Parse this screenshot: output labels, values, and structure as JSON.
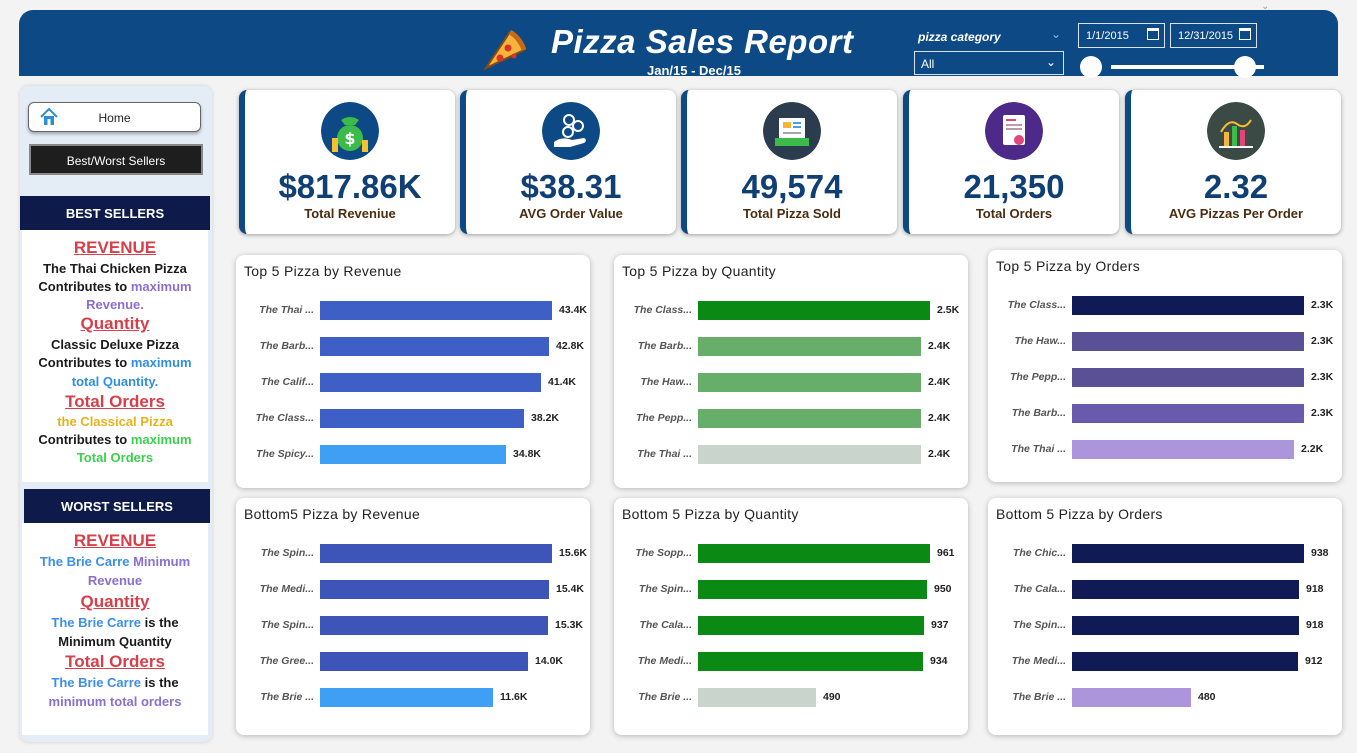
{
  "header": {
    "title": "Pizza Sales Report",
    "subtitle": "Jan/15 - Dec/15",
    "category_label": "pizza category",
    "category_value": "All",
    "date_start": "1/1/2015",
    "date_end": "12/31/2015"
  },
  "sidebar": {
    "home_label": "Home",
    "bw_label": "Best/Worst Sellers",
    "best": {
      "heading": "BEST SELLERS",
      "revenue_h": "REVENUE",
      "revenue_l1": "The Thai Chicken Pizza",
      "revenue_l2a": "Contributes to",
      "revenue_l2b": "maximum",
      "revenue_l3": "Revenue.",
      "quantity_h": "Quantity",
      "quantity_l1": "Classic Deluxe Pizza",
      "quantity_l2a": "Contributes to",
      "quantity_l2b": "maximum",
      "quantity_l3": "total Quantity.",
      "orders_h": "Total Orders",
      "orders_l1": "the Classical Pizza",
      "orders_l2a": "Contributes to",
      "orders_l2b": "maximum",
      "orders_l3": "Total Orders"
    },
    "worst": {
      "heading": "WORST SELLERS",
      "revenue_h": "REVENUE",
      "revenue_l1a": "The Brie Carre",
      "revenue_l1b": "Minimum",
      "revenue_l2": "Revenue",
      "quantity_h": "Quantity",
      "quantity_l1a": "The Brie Carre",
      "quantity_l1b": "is the",
      "quantity_l2": "Minimum Quantity",
      "orders_h": "Total Orders",
      "orders_l1a": "The Brie Carre",
      "orders_l1b": "is the",
      "orders_l2": "minimum total orders"
    }
  },
  "kpis": [
    {
      "value": "$817.86K",
      "label": "Total Reveniue",
      "icon": "money-bag-icon",
      "color": "#0d4a85"
    },
    {
      "value": "$38.31",
      "label": "AVG Order Value",
      "icon": "hand-coins-icon",
      "color": "#0d4a85"
    },
    {
      "value": "49,574",
      "label": "Total Pizza Sold",
      "icon": "receipt-icon",
      "color": "#2b3c4e"
    },
    {
      "value": "21,350",
      "label": "Total Orders",
      "icon": "invoice-icon",
      "color": "#4d2a8a"
    },
    {
      "value": "2.32",
      "label": "AVG Pizzas Per Order",
      "icon": "bar-chart-icon",
      "color": "#3b4a45"
    }
  ],
  "chart_data": [
    {
      "type": "bar",
      "title": "Top 5 Pizza by Revenue",
      "categories": [
        "The Thai ...",
        "The Barb...",
        "The Calif...",
        "The Class...",
        "The Spicy..."
      ],
      "values": [
        43.4,
        42.8,
        41.4,
        38.2,
        34.8
      ],
      "labels": [
        "43.4K",
        "42.8K",
        "41.4K",
        "38.2K",
        "34.8K"
      ],
      "colors": [
        "#3d5fc6",
        "#3d5fc6",
        "#3d5fc6",
        "#3d5fc6",
        "#3f9ff5"
      ]
    },
    {
      "type": "bar",
      "title": "Top 5 Pizza by Quantity",
      "categories": [
        "The Class...",
        "The Barb...",
        "The Haw...",
        "The Pepp...",
        "The Thai ..."
      ],
      "values": [
        2.5,
        2.4,
        2.4,
        2.4,
        2.4
      ],
      "labels": [
        "2.5K",
        "2.4K",
        "2.4K",
        "2.4K",
        "2.4K"
      ],
      "colors": [
        "#0a8a14",
        "#66ae6a",
        "#66ae6a",
        "#66ae6a",
        "#c8d4cc"
      ]
    },
    {
      "type": "bar",
      "title": "Top 5 Pizza by Orders",
      "categories": [
        "The Class...",
        "The Haw...",
        "The Pepp...",
        "The Barb...",
        "The Thai ..."
      ],
      "values": [
        2.3,
        2.3,
        2.3,
        2.3,
        2.2
      ],
      "labels": [
        "2.3K",
        "2.3K",
        "2.3K",
        "2.3K",
        "2.2K"
      ],
      "colors": [
        "#101a55",
        "#5a5096",
        "#5a5096",
        "#6a5aae",
        "#ad95dc"
      ]
    },
    {
      "type": "bar",
      "title": "Bottom5 Pizza by Revenue",
      "categories": [
        "The Spin...",
        "The Medi...",
        "The Spin...",
        "The Gree...",
        "The Brie ..."
      ],
      "values": [
        15.6,
        15.4,
        15.3,
        14.0,
        11.6
      ],
      "labels": [
        "15.6K",
        "15.4K",
        "15.3K",
        "14.0K",
        "11.6K"
      ],
      "colors": [
        "#3d55b8",
        "#3d55b8",
        "#3d55b8",
        "#3d55b8",
        "#3f9ff5"
      ]
    },
    {
      "type": "bar",
      "title": "Bottom 5 Pizza by Quantity",
      "categories": [
        "The Sopp...",
        "The Spin...",
        "The Cala...",
        "The Medi...",
        "The Brie ..."
      ],
      "values": [
        961,
        950,
        937,
        934,
        490
      ],
      "labels": [
        "961",
        "950",
        "937",
        "934",
        "490"
      ],
      "colors": [
        "#0a8a14",
        "#0a8a14",
        "#0a8a14",
        "#0a8a14",
        "#c8d4cc"
      ]
    },
    {
      "type": "bar",
      "title": "Bottom 5 Pizza by Orders",
      "categories": [
        "The Chic...",
        "The Cala...",
        "The Spin...",
        "The Medi...",
        "The Brie ..."
      ],
      "values": [
        938,
        918,
        918,
        912,
        480
      ],
      "labels": [
        "938",
        "918",
        "918",
        "912",
        "480"
      ],
      "colors": [
        "#101a55",
        "#101a55",
        "#101a55",
        "#101a55",
        "#ad95dc"
      ]
    }
  ]
}
